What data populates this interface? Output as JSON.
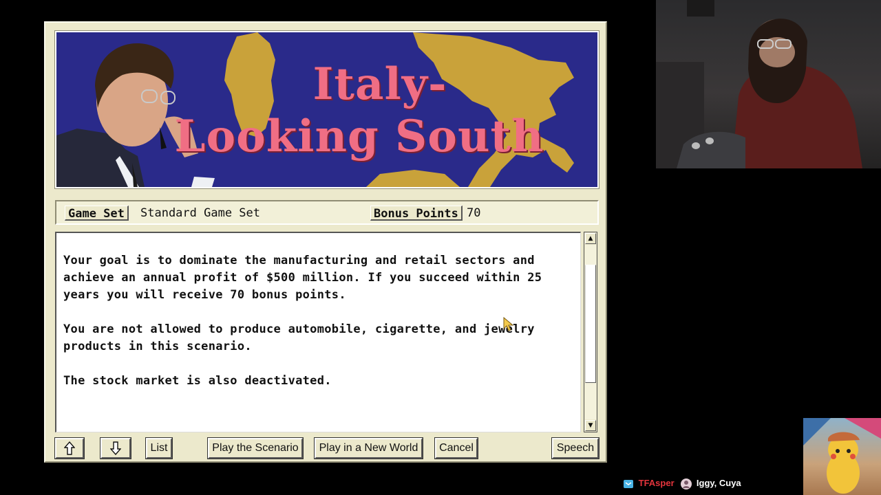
{
  "scenario": {
    "title_line1": "Italy-",
    "title_line2": "Looking South",
    "game_set_label": "Game Set",
    "game_set_value": "Standard Game Set",
    "bonus_label": "Bonus Points",
    "bonus_value": "70",
    "description": [
      "Your goal is to dominate the manufacturing and retail sectors and achieve an annual profit of $500 million. If you succeed within 25 years you will receive 70 bonus points.",
      "You are not allowed to produce automobile, cigarette, and jewelry products in this scenario.",
      "The stock market is also deactivated."
    ]
  },
  "buttons": {
    "up_icon": "up-arrow-icon",
    "down_icon": "down-arrow-icon",
    "list": "List",
    "play_scenario": "Play the Scenario",
    "play_new_world": "Play in a New World",
    "cancel": "Cancel",
    "speech": "Speech"
  },
  "scroll": {
    "position": 0.35
  },
  "colors": {
    "banner_bg": "#2a2a8a",
    "title_pink": "#f06e84",
    "map_gold": "#c9a23a",
    "window_bg": "#ece9cc",
    "viewer_name": "#e3343c"
  },
  "stream": {
    "viewer_name": "TFAsper",
    "other_viewers": "Iggy, Cuya"
  }
}
